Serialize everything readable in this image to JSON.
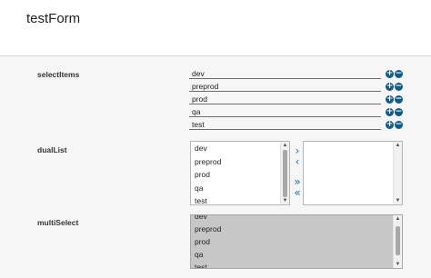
{
  "form": {
    "title": "testForm"
  },
  "selectItems": {
    "label": "selectItems",
    "items": [
      "dev",
      "preprod",
      "prod",
      "qa",
      "test"
    ],
    "add_icon": "plus-circle-icon",
    "remove_icon": "minus-circle-icon"
  },
  "dualList": {
    "label": "dualList",
    "available": [
      "dev",
      "preprod",
      "prod",
      "qa",
      "test"
    ],
    "selected": [],
    "buttons": {
      "move_right": "›",
      "move_left": "‹",
      "move_all_right": "»",
      "move_all_left": "«"
    }
  },
  "multiSelect": {
    "label": "multiSelect",
    "options": [
      "dev",
      "preprod",
      "prod",
      "qa",
      "test"
    ]
  },
  "colors": {
    "icon_blue": "#0f5b89",
    "arrow_blue": "#1c6fa8",
    "multi_bg": "#c7c7c7",
    "body_bg": "#f6f6f6"
  }
}
